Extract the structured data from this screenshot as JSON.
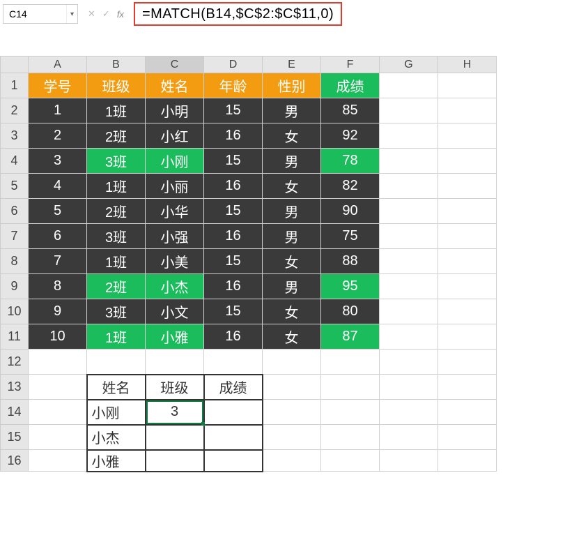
{
  "namebox": {
    "value": "C14"
  },
  "formula_bar": {
    "value": "=MATCH(B14,$C$2:$C$11,0)"
  },
  "columns": [
    "A",
    "B",
    "C",
    "D",
    "E",
    "F",
    "G",
    "H"
  ],
  "selected_col": "C",
  "headers_main": [
    "学号",
    "班级",
    "姓名",
    "年龄",
    "性别",
    "成绩"
  ],
  "rows": [
    {
      "id": "1",
      "class": "1班",
      "name": "小明",
      "age": "15",
      "sex": "男",
      "score": "85",
      "hl": []
    },
    {
      "id": "2",
      "class": "2班",
      "name": "小红",
      "age": "16",
      "sex": "女",
      "score": "92",
      "hl": []
    },
    {
      "id": "3",
      "class": "3班",
      "name": "小刚",
      "age": "15",
      "sex": "男",
      "score": "78",
      "hl": [
        "class",
        "name",
        "score"
      ]
    },
    {
      "id": "4",
      "class": "1班",
      "name": "小丽",
      "age": "16",
      "sex": "女",
      "score": "82",
      "hl": []
    },
    {
      "id": "5",
      "class": "2班",
      "name": "小华",
      "age": "15",
      "sex": "男",
      "score": "90",
      "hl": []
    },
    {
      "id": "6",
      "class": "3班",
      "name": "小强",
      "age": "16",
      "sex": "男",
      "score": "75",
      "hl": []
    },
    {
      "id": "7",
      "class": "1班",
      "name": "小美",
      "age": "15",
      "sex": "女",
      "score": "88",
      "hl": []
    },
    {
      "id": "8",
      "class": "2班",
      "name": "小杰",
      "age": "16",
      "sex": "男",
      "score": "95",
      "hl": [
        "class",
        "name",
        "score"
      ]
    },
    {
      "id": "9",
      "class": "3班",
      "name": "小文",
      "age": "15",
      "sex": "女",
      "score": "80",
      "hl": []
    },
    {
      "id": "10",
      "class": "1班",
      "name": "小雅",
      "age": "16",
      "sex": "女",
      "score": "87",
      "hl": [
        "class",
        "name",
        "score"
      ]
    }
  ],
  "lookup": {
    "headers": [
      "姓名",
      "班级",
      "成绩"
    ],
    "rows": [
      {
        "name": "小刚",
        "class": "3",
        "score": ""
      },
      {
        "name": "小杰",
        "class": "",
        "score": ""
      },
      {
        "name": "小雅",
        "class": "",
        "score": ""
      }
    ],
    "selected_row": 0,
    "selected_col": 1
  }
}
